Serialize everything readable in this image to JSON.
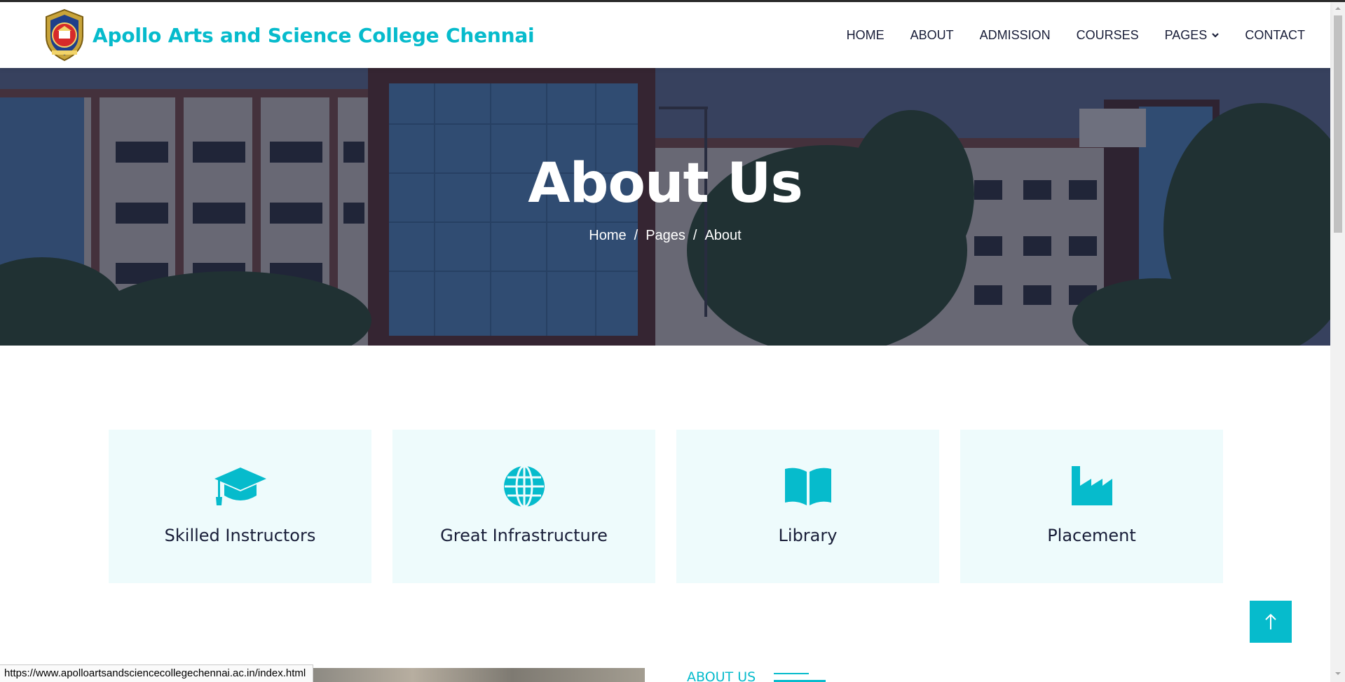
{
  "browser": {
    "status_url": "https://www.apolloartsandsciencecollegechennai.ac.in/index.html"
  },
  "header": {
    "brand_name": "Apollo Arts and Science College Chennai",
    "nav": [
      {
        "label": "HOME"
      },
      {
        "label": "ABOUT"
      },
      {
        "label": "ADMISSION"
      },
      {
        "label": "COURSES"
      },
      {
        "label": "PAGES",
        "has_dropdown": true
      },
      {
        "label": "CONTACT"
      }
    ]
  },
  "hero": {
    "title": "About Us",
    "breadcrumb": [
      "Home",
      "Pages",
      "About"
    ]
  },
  "features": [
    {
      "label": "Skilled Instructors",
      "icon": "graduation-cap-icon"
    },
    {
      "label": "Great Infrastructure",
      "icon": "globe-icon"
    },
    {
      "label": "Library",
      "icon": "book-open-icon"
    },
    {
      "label": "Placement",
      "icon": "industry-icon"
    }
  ],
  "about_section": {
    "label": "ABOUT US"
  },
  "colors": {
    "accent": "#06bbcc",
    "dark": "#181d38",
    "card_bg": "#eefbfc"
  }
}
